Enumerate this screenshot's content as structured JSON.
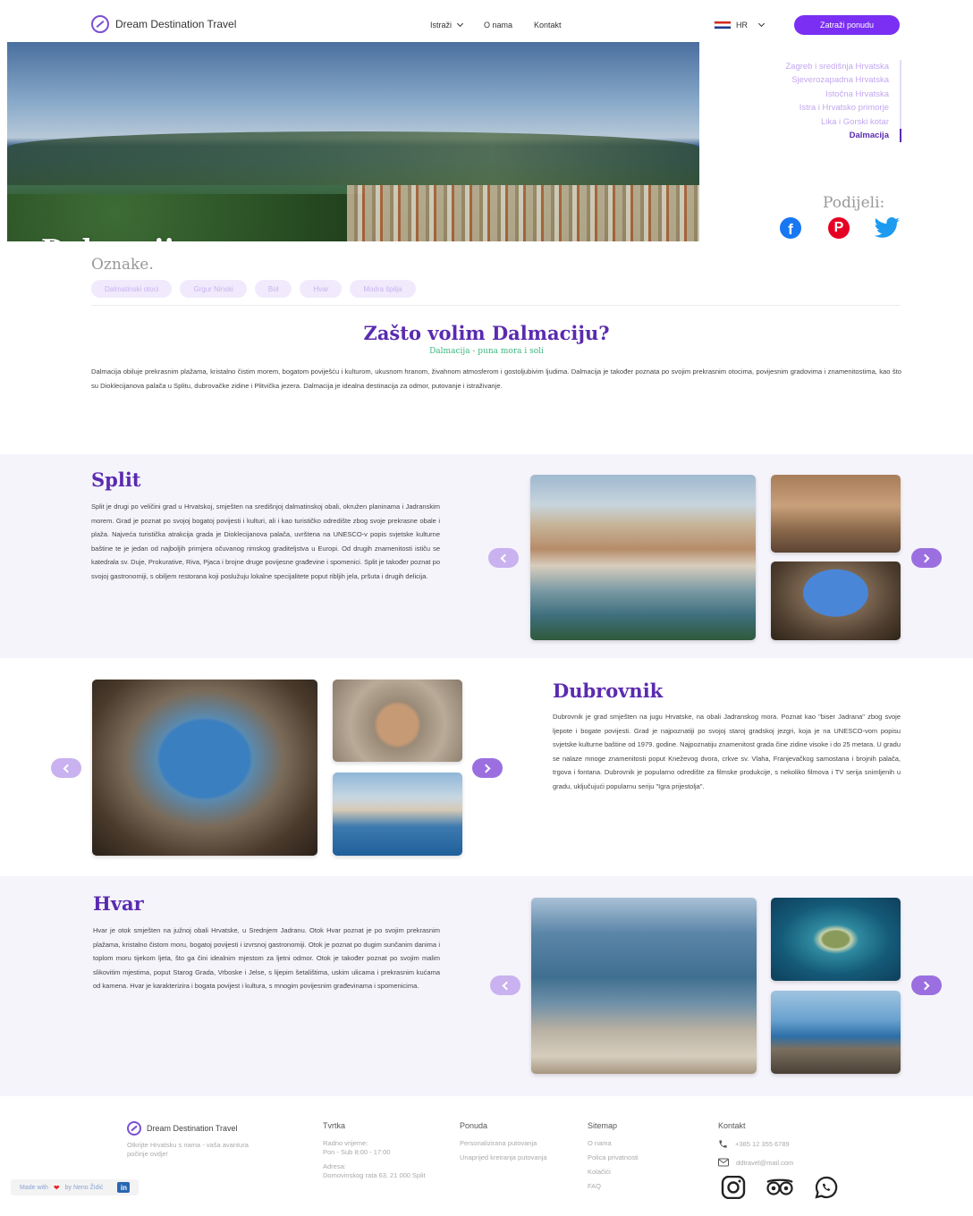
{
  "nav": {
    "brand": "Dream Destination Travel",
    "links": [
      "Istraži",
      "O nama",
      "Kontakt"
    ],
    "lang": "HR",
    "cta": "Zatraži ponudu"
  },
  "hero": {
    "title": "Dalmacija"
  },
  "regions": {
    "items": [
      "Zagreb i središnja Hrvatska",
      "Sjeverozapadna Hrvatska",
      "Istočna Hrvatska",
      "Istra i Hrvatsko primorje",
      "Lika i Gorski kotar",
      "Dalmacija"
    ],
    "active": "Dalmacija"
  },
  "share": {
    "label": "Podijeli:",
    "icons": [
      "facebook-icon",
      "pinterest-icon",
      "twitter-icon"
    ]
  },
  "tags": {
    "label": "Oznake.",
    "items": [
      "Dalmatinski otoci",
      "Grgur Ninski",
      "Bol",
      "Hvar",
      "Modra špilja"
    ]
  },
  "intro": {
    "title": "Zašto volim Dalmaciju?",
    "subtitle": "Dalmacija - puna mora i soli",
    "text": "Dalmacija obiluje prekrasnim plažama, kristalno čistim morem, bogatom poviješću i kulturom, ukusnom hranom, živahnom atmosferom i gostoljubivim ljudima. Dalmacija je također poznata po svojim prekrasnim otocima, povijesnim gradovima i znamenitostima, kao što su Dioklecijanova palača u Splitu, dubrovačke zidine i Plitvička jezera. Dalmacija je idealna destinacija za odmor, putovanje i istraživanje."
  },
  "sections": [
    {
      "title": "Split",
      "text": "Split je drugi po veličini grad u Hrvatskoj, smješten na središnjoj dalmatinskoj obali, okružen planinama i Jadranskim morem. Grad je poznat po svojoj bogatoj povijesti i kulturi, ali i kao turističko odredište zbog svoje prekrasne obale i plaža. Najveća turistička atrakcija grada je Dioklecijanova palača, uvrštena na UNESCO-v popis svjetske kulturne baštine te je jedan od najboljih primjera očuvanog rimskog graditeljstva u Europi. Od drugih znamenitosti ističu se katedrala sv. Duje, Prokurative, Riva, Pjaca i brojne druge povijesne građevine i spomenici. Split je također poznat po svojoj gastronomiji, s obiljem restorana koji poslužuju lokalne specijalitete poput ribljih jela, pršuta i drugih delicija."
    },
    {
      "title": "Dubrovnik",
      "text": "Dubrovnik je grad smješten na jugu Hrvatske, na obali Jadranskog mora. Poznat kao \"biser Jadrana\" zbog svoje ljepote i bogate povijesti. Grad je najpoznatiji po svojoj staroj gradskoj jezgri, koja je na UNESCO-vom popisu svjetske kulturne baštine od 1979. godine. Najpoznatiju znamenitost grada čine zidine visoke i do 25 metara. U gradu se nalaze mnoge znamenitosti poput Kneževog dvora, crkve sv. Vlaha, Franjevačkog samostana i brojnih palača, trgova i fontana. Dubrovnik je popularno odredište za filmske produkcije, s nekoliko filmova i TV serija snimljenih u gradu, uključujući popularnu seriju \"Igra prijestolja\"."
    },
    {
      "title": "Hvar",
      "text": "Hvar je otok smješten na južnoj obali Hrvatske, u Srednjem Jadranu. Otok Hvar poznat je po svojim prekrasnim plažama, kristalno čistom moru, bogatoj povijesti i izvrsnoj gastronomiji. Otok je poznat po dugim sunčanim danima i toplom moru tijekom ljeta, što ga čini idealnim mjestom za ljetni odmor. Otok je također poznat po svojim malim slikovitim mjestima, poput Starog Grada, Vrboske i Jelse, s lijepim šetalištima, uskim ulicama i prekrasnim kućama od kamena. Hvar je karakterizira i bogata povijest i kultura, s mnogim povijesnim građevinama i spomenicima."
    }
  ],
  "footer": {
    "brand": "Dream Destination Travel",
    "tagline": "Otkrijte Hrvatsku s nama - vaša avantura počinje ovdje!",
    "company": {
      "title": "Tvrtka",
      "hours_label": "Radno vrijeme:",
      "hours": "Pon - Sub 8:00 - 17:00",
      "address_label": "Adresa:",
      "address": "Domovinskog rata 63, 21 000 Split"
    },
    "offer": {
      "title": "Ponuda",
      "items": [
        "Personalizirana putovanja",
        "Unaprijed kreiranja putovanja"
      ]
    },
    "sitemap": {
      "title": "Sitemap",
      "items": [
        "O nama",
        "Polica privatnosti",
        "Kolačići",
        "FAQ"
      ]
    },
    "contact": {
      "title": "Kontakt",
      "phone": "+385 12 355 6789",
      "email": "ddtravel@mail.com",
      "icons": [
        "instagram-icon",
        "tripadvisor-icon",
        "whatsapp-icon"
      ]
    },
    "made_with": {
      "prefix": "Made with",
      "suffix": "by Neno Židić",
      "badge": "in"
    }
  },
  "colors": {
    "accent": "#7b2ff2",
    "title": "#5a2bb0",
    "green": "#3ab87f",
    "band": "#f5f4fb"
  }
}
